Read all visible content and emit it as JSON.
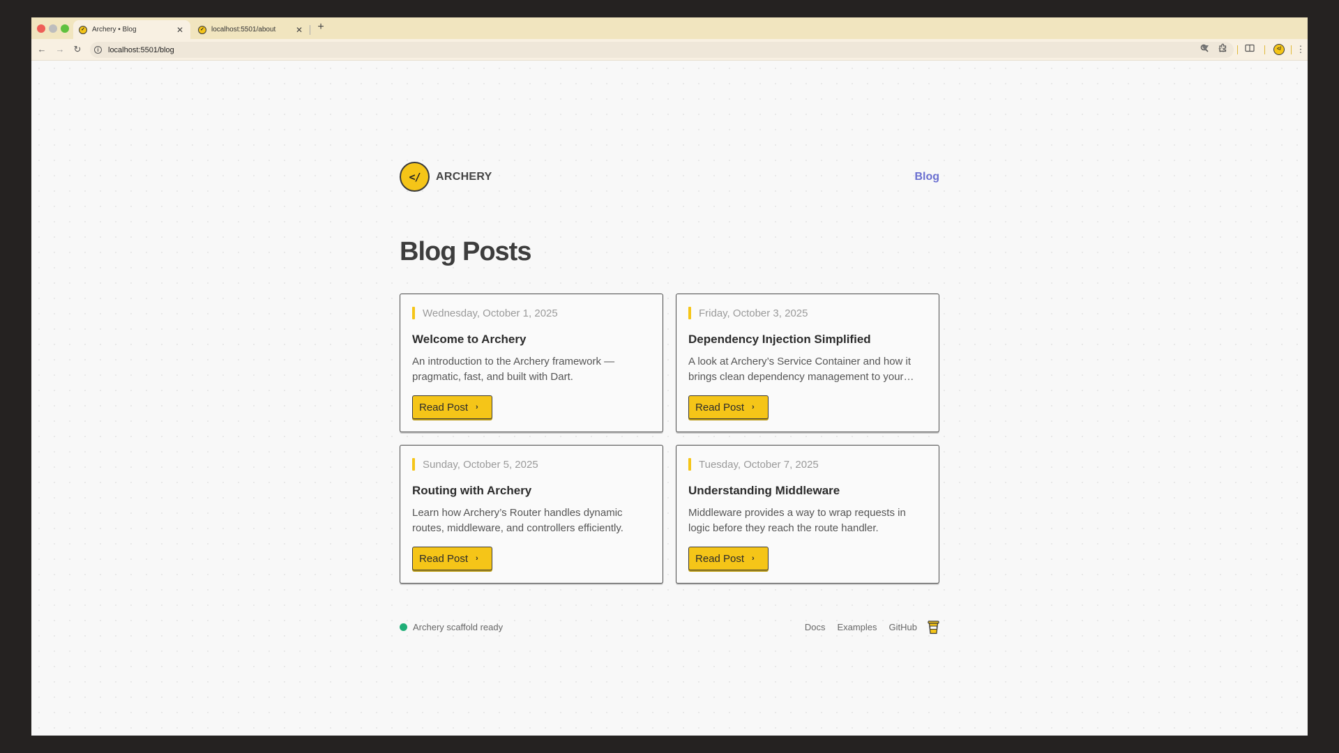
{
  "browser": {
    "tabs": [
      {
        "title": "Archery • Blog",
        "favicon": "archery-logo-icon",
        "active": true
      },
      {
        "title": "localhost:5501/about",
        "favicon": "archery-logo-icon",
        "active": false
      }
    ],
    "new_tab_label": "+",
    "url": "localhost:5501/blog",
    "profile_label": "</",
    "colors": {
      "tab_strip": "#f1e5bf",
      "toolbar": "#f8f0e2"
    }
  },
  "site": {
    "logo_text": "</",
    "brand": "ARCHERY",
    "nav": [
      {
        "label": "Blog",
        "color": "#6a6fd0"
      }
    ]
  },
  "main": {
    "title": "Blog Posts",
    "posts": [
      {
        "date": "Wednesday, October 1, 2025",
        "title": "Welcome to Archery",
        "description": "An introduction to the Archery framework — pragmatic, fast, and built with Dart.",
        "button_label": "Read Post"
      },
      {
        "date": "Friday, October 3, 2025",
        "title": "Dependency Injection Simplified",
        "description": "A look at Archery’s Service Container and how it brings clean dependency management to your…",
        "button_label": "Read Post"
      },
      {
        "date": "Sunday, October 5, 2025",
        "title": "Routing with Archery",
        "description": "Learn how Archery’s Router handles dynamic routes, middleware, and controllers efficiently.",
        "button_label": "Read Post"
      },
      {
        "date": "Tuesday, October 7, 2025",
        "title": "Understanding Middleware",
        "description": "Middleware provides a way to wrap requests in logic before they reach the route handler.",
        "button_label": "Read Post"
      }
    ]
  },
  "footer": {
    "status_text": "Archery scaffold ready",
    "status_color": "#1fae77",
    "links": [
      "Docs",
      "Examples",
      "GitHub"
    ],
    "icon": "coffee-cup-icon"
  },
  "accent_color": "#f5c518"
}
